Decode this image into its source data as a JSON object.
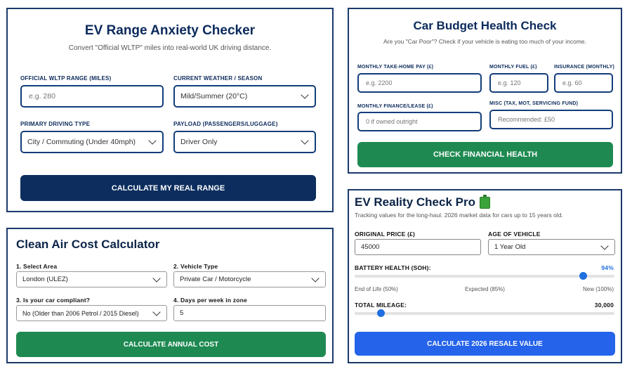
{
  "ev_range": {
    "title": "EV Range Anxiety Checker",
    "subtitle": "Convert \"Official WLTP\" miles into real-world UK driving distance.",
    "wltp_label": "Official WLTP Range (Miles)",
    "wltp_placeholder": "e.g. 280",
    "weather_label": "Current Weather / Season",
    "weather_value": "Mild/Summer (20°C)",
    "driving_label": "Primary Driving Type",
    "driving_value": "City / Commuting (Under 40mph)",
    "payload_label": "Payload (Passengers/Luggage)",
    "payload_value": "Driver Only",
    "button": "Calculate My Real Range",
    "button_color": "#0c2d5e"
  },
  "budget": {
    "title": "Car Budget Health Check",
    "subtitle": "Are you \"Car Poor\"? Check if your vehicle is eating too much of your income.",
    "takehome_label": "Monthly Take-Home Pay (£)",
    "takehome_placeholder": "e.g. 2200",
    "fuel_label": "Monthly Fuel (£)",
    "fuel_placeholder": "e.g. 120",
    "insurance_label": "Insurance (Monthly)",
    "insurance_placeholder": "e.g. 60",
    "finance_label": "Monthly Finance/Lease (£)",
    "finance_placeholder": "0 if owned outright",
    "misc_label": "Misc (Tax, MOT, Servicing Fund)",
    "misc_placeholder": "Recommended: £50",
    "button": "Check Financial Health",
    "button_color": "#1e8a52"
  },
  "clean_air": {
    "title": "Clean Air Cost Calculator",
    "area_label": "1. Select Area",
    "area_value": "London (ULEZ)",
    "vehicle_label": "2. Vehicle Type",
    "vehicle_value": "Private Car / Motorcycle",
    "compliant_label": "3. Is your car compliant?",
    "compliant_value": "No (Older than 2006 Petrol / 2015 Diesel)",
    "days_label": "4. Days per week in zone",
    "days_value": "5",
    "button": "Calculate Annual Cost",
    "button_color": "#1e8a52"
  },
  "reality": {
    "title": "EV Reality Check Pro",
    "battery_icon": "battery-icon",
    "subtitle": "Tracking values for the long-haul. 2026 market data for cars up to 15 years old.",
    "price_label": "Original Price (£)",
    "price_value": "45000",
    "age_label": "Age of Vehicle",
    "age_value": "1 Year Old",
    "battery_label": "Battery Health (SoH):",
    "battery_value": "94%",
    "battery_fraction": 0.94,
    "scale_low": "End of Life (50%)",
    "scale_mid": "Expected (85%)",
    "scale_high": "New (100%)",
    "mileage_label": "Total Mileage:",
    "mileage_value": "30,000",
    "mileage_fraction": 0.1,
    "button": "Calculate 2026 Resale Value",
    "button_color": "#2563eb",
    "accent": "#1f6fe0"
  }
}
